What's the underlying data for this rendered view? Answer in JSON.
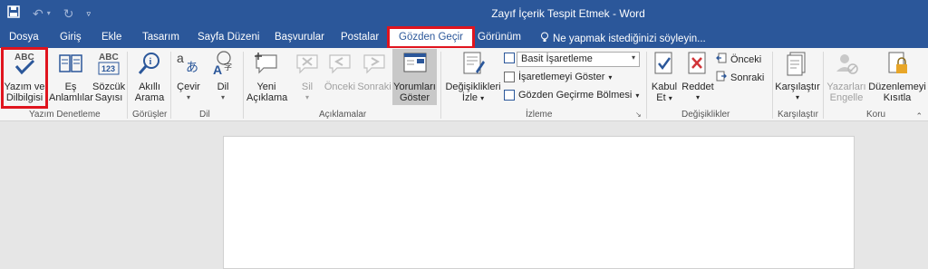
{
  "window": {
    "title": "Zayıf İçerik Tespit Etmek - Word"
  },
  "qat": {
    "save_icon": "save-icon",
    "undo_icon": "undo-icon",
    "redo_icon": "redo-icon",
    "customize_icon": "customize-qat-icon"
  },
  "tabs": [
    {
      "label": "Dosya"
    },
    {
      "label": "Giriş"
    },
    {
      "label": "Ekle"
    },
    {
      "label": "Tasarım"
    },
    {
      "label": "Sayfa Düzeni"
    },
    {
      "label": "Başvurular"
    },
    {
      "label": "Postalar"
    },
    {
      "label": "Gözden Geçir"
    },
    {
      "label": "Görünüm"
    }
  ],
  "tell_me": "Ne yapmak istediğinizi söyleyin...",
  "groups": {
    "proofing": {
      "label": "Yazım Denetleme",
      "spelling": "Yazım ve Dilbilgisi",
      "thesaurus": "Eş Anlamlılar",
      "wordcount": "Sözcük Sayısı",
      "abc": "ABC",
      "abc123": "ABC 123"
    },
    "insights": {
      "label": "Görüşler",
      "smartlookup": "Akıllı Arama"
    },
    "language": {
      "label": "Dil",
      "translate": "Çevir",
      "language": "Dil"
    },
    "comments": {
      "label": "Açıklamalar",
      "new": "Yeni Açıklama",
      "delete": "Sil",
      "prev": "Önceki",
      "next": "Sonraki",
      "show": "Yorumları Göster"
    },
    "tracking": {
      "label": "İzleme",
      "track": "Değişiklikleri İzle",
      "markup_dropdown": "Basit İşaretleme",
      "show_markup": "İşaretlemeyi Göster",
      "reviewing_pane": "Gözden Geçirme Bölmesi"
    },
    "changes": {
      "label": "Değişiklikler",
      "accept": "Kabul Et",
      "reject": "Reddet",
      "prev": "Önceki",
      "next": "Sonraki"
    },
    "compare": {
      "label": "Karşılaştır",
      "compare": "Karşılaştır"
    },
    "protect": {
      "label": "Koru",
      "block_authors": "Yazarları Engelle",
      "restrict": "Düzenlemeyi Kısıtla"
    }
  }
}
